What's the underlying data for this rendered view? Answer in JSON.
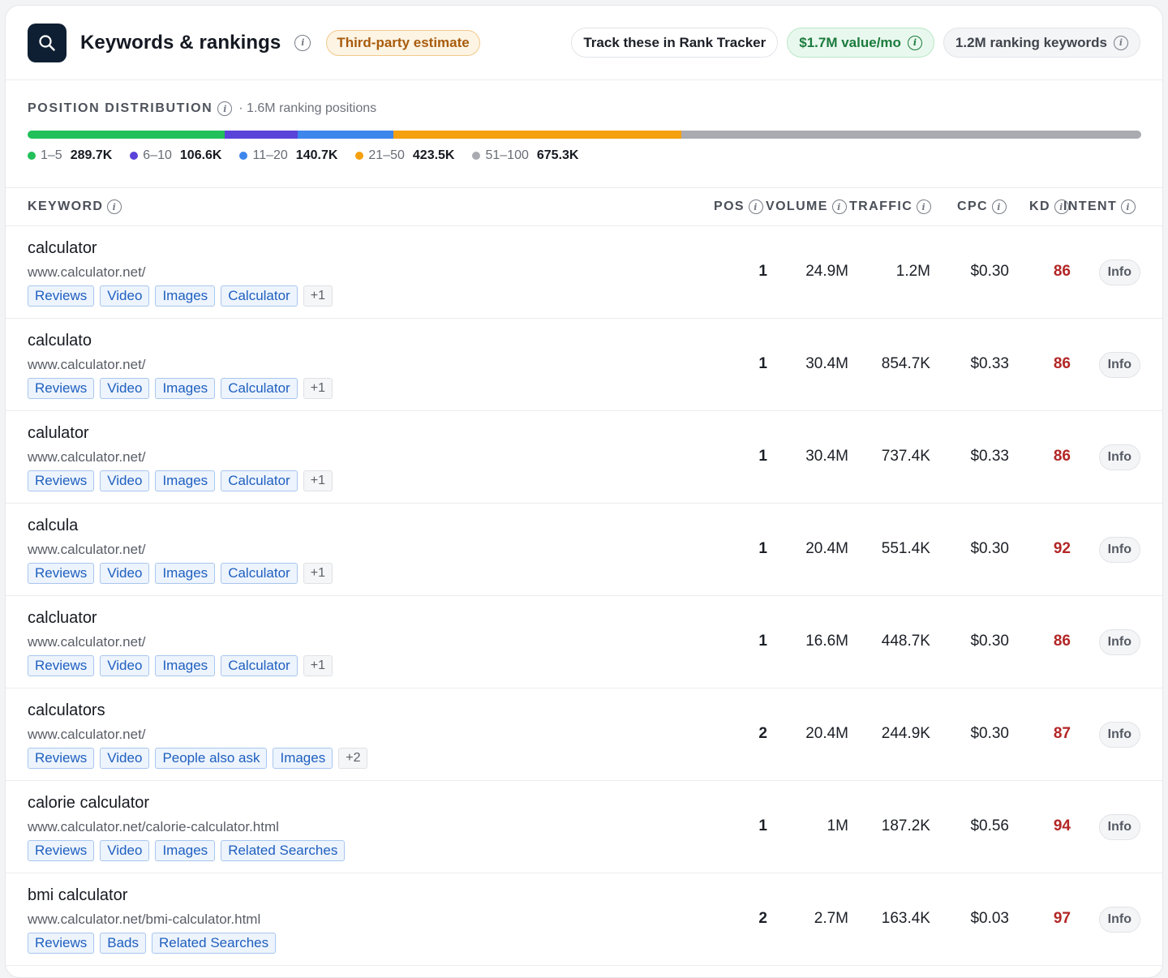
{
  "header": {
    "title": "Keywords & rankings",
    "estimate_badge": "Third-party estimate",
    "track_button": "Track these in Rank Tracker",
    "value_pill": "$1.7M value/mo",
    "ranking_pill": "1.2M ranking keywords"
  },
  "distribution": {
    "label": "POSITION DISTRIBUTION",
    "subtitle": "· 1.6M ranking positions",
    "segments": [
      {
        "range": "1–5",
        "value": "289.7K",
        "count": 289.7,
        "color": "#22c05a"
      },
      {
        "range": "6–10",
        "value": "106.6K",
        "count": 106.6,
        "color": "#5a43d9"
      },
      {
        "range": "11–20",
        "value": "140.7K",
        "count": 140.7,
        "color": "#3d86ec"
      },
      {
        "range": "21–50",
        "value": "423.5K",
        "count": 423.5,
        "color": "#f5a00f"
      },
      {
        "range": "51–100",
        "value": "675.3K",
        "count": 675.3,
        "color": "#aaabb0"
      }
    ]
  },
  "table": {
    "columns": {
      "keyword": "KEYWORD",
      "pos": "POS",
      "volume": "VOLUME",
      "traffic": "TRAFFIC",
      "cpc": "CPC",
      "kd": "KD",
      "intent": "INTENT"
    },
    "rows": [
      {
        "keyword": "calculator",
        "url": "www.calculator.net/",
        "tags": [
          "Reviews",
          "Video",
          "Images",
          "Calculator"
        ],
        "more": "+1",
        "pos": "1",
        "volume": "24.9M",
        "traffic": "1.2M",
        "cpc": "$0.30",
        "kd": "86",
        "intent": "Info"
      },
      {
        "keyword": "calculato",
        "url": "www.calculator.net/",
        "tags": [
          "Reviews",
          "Video",
          "Images",
          "Calculator"
        ],
        "more": "+1",
        "pos": "1",
        "volume": "30.4M",
        "traffic": "854.7K",
        "cpc": "$0.33",
        "kd": "86",
        "intent": "Info"
      },
      {
        "keyword": "calulator",
        "url": "www.calculator.net/",
        "tags": [
          "Reviews",
          "Video",
          "Images",
          "Calculator"
        ],
        "more": "+1",
        "pos": "1",
        "volume": "30.4M",
        "traffic": "737.4K",
        "cpc": "$0.33",
        "kd": "86",
        "intent": "Info"
      },
      {
        "keyword": "calcula",
        "url": "www.calculator.net/",
        "tags": [
          "Reviews",
          "Video",
          "Images",
          "Calculator"
        ],
        "more": "+1",
        "pos": "1",
        "volume": "20.4M",
        "traffic": "551.4K",
        "cpc": "$0.30",
        "kd": "92",
        "intent": "Info"
      },
      {
        "keyword": "calcluator",
        "url": "www.calculator.net/",
        "tags": [
          "Reviews",
          "Video",
          "Images",
          "Calculator"
        ],
        "more": "+1",
        "pos": "1",
        "volume": "16.6M",
        "traffic": "448.7K",
        "cpc": "$0.30",
        "kd": "86",
        "intent": "Info"
      },
      {
        "keyword": "calculators",
        "url": "www.calculator.net/",
        "tags": [
          "Reviews",
          "Video",
          "People also ask",
          "Images"
        ],
        "more": "+2",
        "pos": "2",
        "volume": "20.4M",
        "traffic": "244.9K",
        "cpc": "$0.30",
        "kd": "87",
        "intent": "Info"
      },
      {
        "keyword": "calorie calculator",
        "url": "www.calculator.net/calorie-calculator.html",
        "tags": [
          "Reviews",
          "Video",
          "Images",
          "Related Searches"
        ],
        "more": "",
        "pos": "1",
        "volume": "1M",
        "traffic": "187.2K",
        "cpc": "$0.56",
        "kd": "94",
        "intent": "Info"
      },
      {
        "keyword": "bmi calculator",
        "url": "www.calculator.net/bmi-calculator.html",
        "tags": [
          "Reviews",
          "Bads",
          "Related Searches"
        ],
        "more": "",
        "pos": "2",
        "volume": "2.7M",
        "traffic": "163.4K",
        "cpc": "$0.03",
        "kd": "97",
        "intent": "Info"
      }
    ]
  }
}
